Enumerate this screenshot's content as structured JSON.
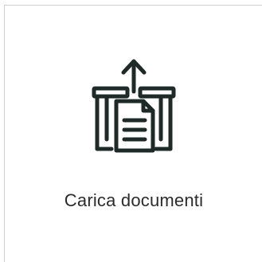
{
  "tile": {
    "label": "Carica documenti",
    "icon": "upload-document-icon"
  },
  "colors": {
    "icon_stroke": "#1f2a28",
    "text": "#2b2b2b",
    "border": "#cfcfcf",
    "background": "#ffffff"
  }
}
